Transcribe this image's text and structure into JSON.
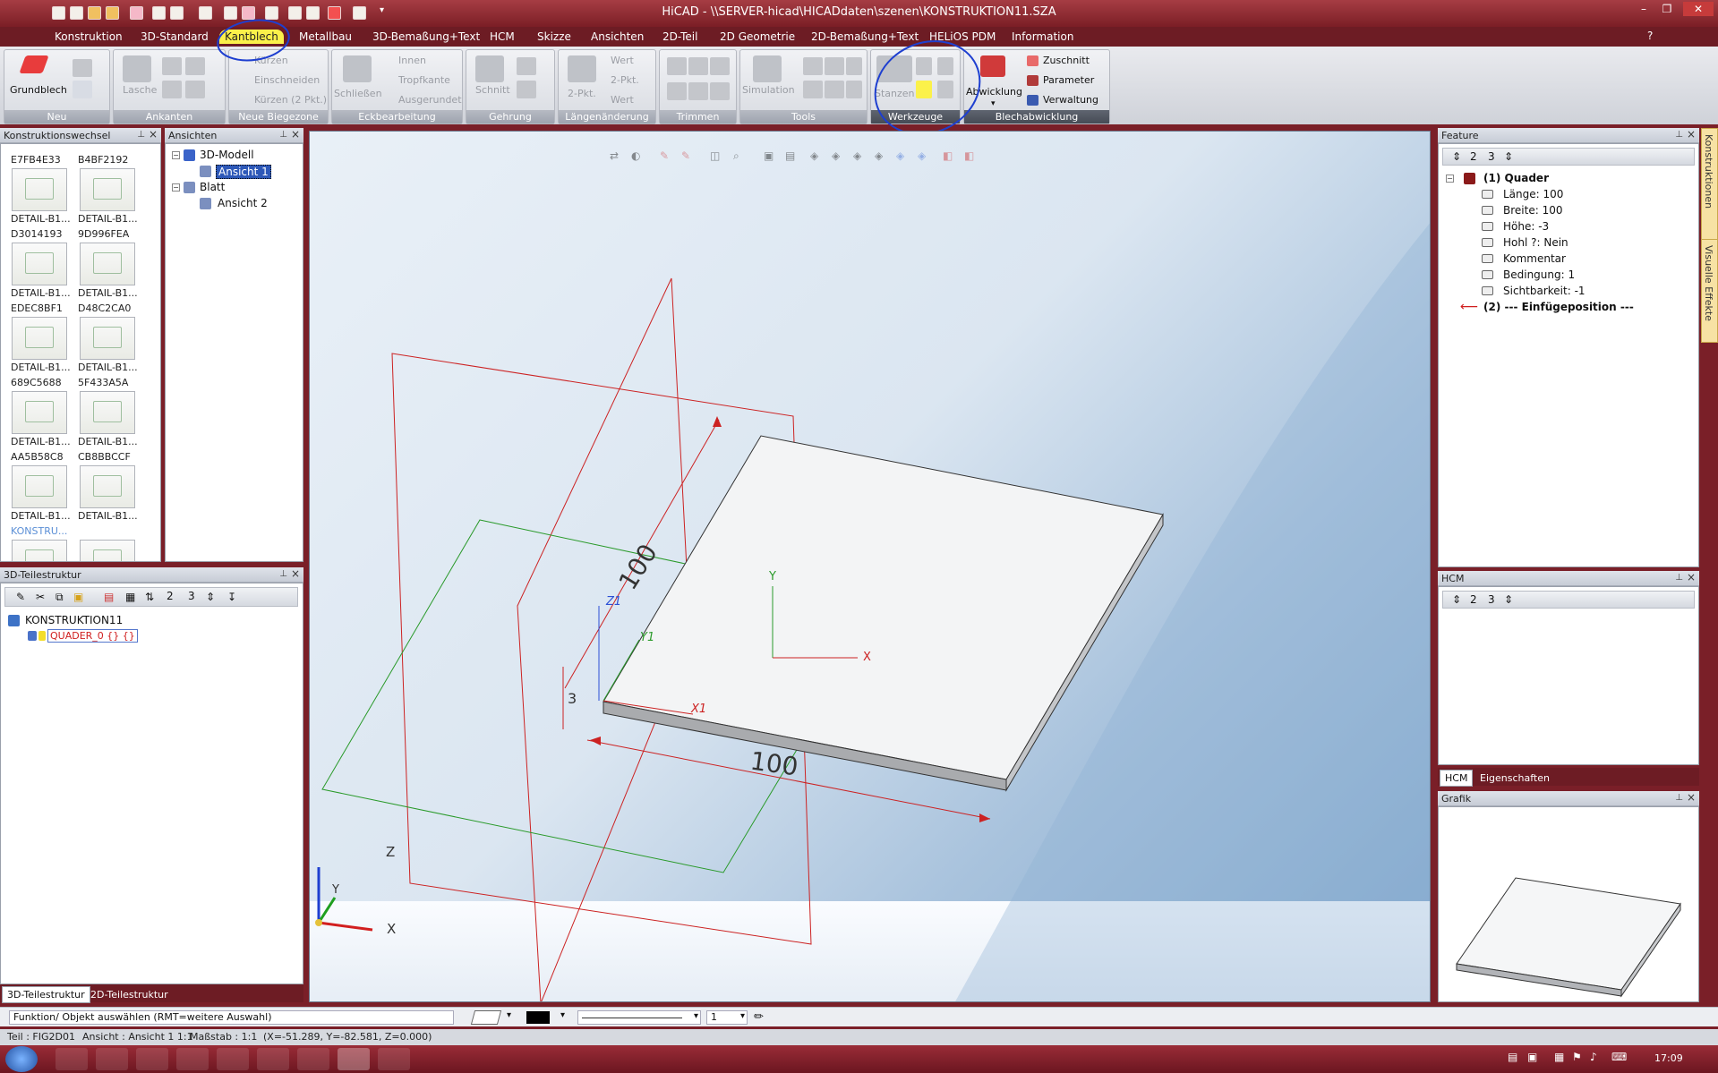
{
  "app": {
    "title": "HiCAD - \\\\SERVER-hicad\\HICADdaten\\szenen\\KONSTRUKTION11.SZA",
    "accent": "#7b1e26",
    "highlight": "#fbf14a",
    "annotation_color": "#1e3fd0"
  },
  "window_buttons": {
    "minimize": "–",
    "restore": "❐",
    "close": "✕"
  },
  "ribbon_tabs": [
    "Konstruktion",
    "3D-Standard",
    "Kantblech",
    "Metallbau",
    "3D-Bemaßung+Text",
    "HCM",
    "Skizze",
    "Ansichten",
    "2D-Teil",
    "2D Geometrie",
    "2D-Bemaßung+Text",
    "HELiOS PDM",
    "Information"
  ],
  "active_tab": "Kantblech",
  "ribbon": {
    "neu": {
      "label": "Neu",
      "grundblech": "Grundblech"
    },
    "ankanten": {
      "label": "Ankanten",
      "lasche": "Lasche"
    },
    "neue_biegezone": {
      "label": "Neue Biegezone",
      "kuerzen": "Kürzen",
      "einschneiden": "Einschneiden",
      "kuerzen2": "Kürzen (2 Pkt.)"
    },
    "eckbearbeitung": {
      "label": "Eckbearbeitung",
      "schliessen": "Schließen",
      "innen": "Innen",
      "tropfkante": "Tropfkante",
      "ausgerundet": "Ausgerundet"
    },
    "gehrung": {
      "label": "Gehrung",
      "schnitt": "Schnitt"
    },
    "laengenaenderung": {
      "label": "Längenänderung",
      "zweipkt": "2-Pkt.",
      "wert1": "Wert",
      "zweipkt2": "2-Pkt.",
      "wert2": "Wert"
    },
    "trimmen": {
      "label": "Trimmen"
    },
    "tools": {
      "label": "Tools",
      "simulation": "Simulation"
    },
    "werkzeuge": {
      "label": "Werkzeuge",
      "stanzen": "Stanzen"
    },
    "blechabwicklung": {
      "label": "Blechabwicklung",
      "abwicklung": "Abwicklung",
      "zuschnitt": "Zuschnitt",
      "parameter": "Parameter",
      "verwaltung": "Verwaltung"
    }
  },
  "konstruktionswechsel": {
    "title": "Konstruktionswechsel",
    "items": [
      {
        "id": "E7FB4E33",
        "name": "DETAIL-B1..."
      },
      {
        "id": "B4BF2192",
        "name": "DETAIL-B1..."
      },
      {
        "id": "D3014193",
        "name": "DETAIL-B1..."
      },
      {
        "id": "9D996FEA",
        "name": "DETAIL-B1..."
      },
      {
        "id": "EDEC8BF1",
        "name": "DETAIL-B1..."
      },
      {
        "id": "D48C2CA0",
        "name": "DETAIL-B1..."
      },
      {
        "id": "689C5688",
        "name": "DETAIL-B1..."
      },
      {
        "id": "5F433A5A",
        "name": "DETAIL-B1..."
      },
      {
        "id": "AA5B58C8",
        "name": "DETAIL-B1..."
      },
      {
        "id": "CB8BBCCF",
        "name": "DETAIL-B1..."
      }
    ],
    "more": "KONSTRU..."
  },
  "ansichten": {
    "title": "Ansichten",
    "model": "3D-Modell",
    "view1": "Ansicht 1",
    "sheet": "Blatt",
    "view2": "Ansicht 2"
  },
  "teilestruktur": {
    "title": "3D-Teilestruktur",
    "root": "KONSTRUKTION11",
    "part": "QUADER_0 {} {}",
    "tab1": "3D-Teilestruktur",
    "tab2": "2D-Teilestruktur",
    "toolbar_nums": [
      "2",
      "3"
    ]
  },
  "feature": {
    "title": "Feature",
    "root": "(1) Quader",
    "params": [
      "Länge: 100",
      "Breite: 100",
      "Höhe: -3",
      "Hohl ?: Nein",
      "Kommentar",
      "Bedingung: 1",
      "Sichtbarkeit: -1"
    ],
    "second": "(2) --- Einfügeposition ---"
  },
  "hcm": {
    "title": "HCM",
    "tab1": "HCM",
    "tab2": "Eigenschaften"
  },
  "grafik": {
    "title": "Grafik"
  },
  "side_tabs": [
    "Konstruktionen",
    "Visuelle Effekte"
  ],
  "viewport": {
    "dim_length": "100",
    "dim_width": "100",
    "dim_height": "3",
    "axis_x": "X",
    "axis_y": "Y",
    "axis_z": "Z",
    "x1": "X1",
    "y1": "Y1",
    "z1": "Z1"
  },
  "command": {
    "prompt": "Funktion/ Objekt auswählen (RMT=weitere Auswahl)",
    "line_width": "1"
  },
  "status": {
    "teil": "Teil : FIG2D01",
    "ansicht": "Ansicht : Ansicht 1 1:1",
    "massstab": "Maßstab : 1:1",
    "coords": "(X=-51.289, Y=-82.581, Z=0.000)"
  },
  "taskbar": {
    "time": "17:09"
  }
}
